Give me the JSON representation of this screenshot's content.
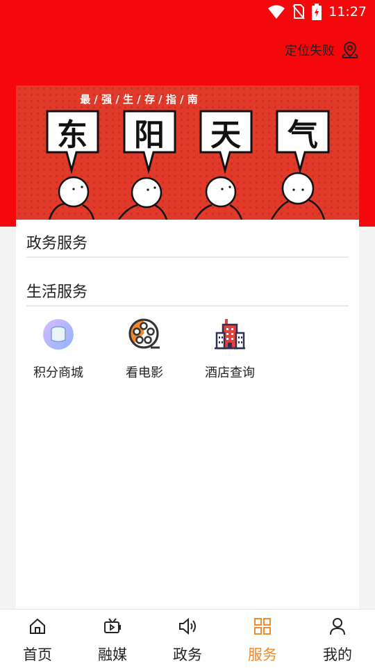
{
  "status_bar": {
    "time": "11:27",
    "icons": [
      "wifi-icon",
      "no-sim-icon",
      "battery-charging-icon"
    ]
  },
  "header": {
    "location_text": "定位失败",
    "location_icon": "map-pin-icon"
  },
  "banner": {
    "tagline": "最 / 强 / 生 / 存 / 指 / 南",
    "characters": [
      "东",
      "阳",
      "天",
      "气"
    ]
  },
  "sections": [
    {
      "title": "政务服务"
    },
    {
      "title": "生活服务"
    }
  ],
  "life_services": [
    {
      "label": "积分商城",
      "icon": "coin-stack-icon"
    },
    {
      "label": "看电影",
      "icon": "film-reel-icon"
    },
    {
      "label": "酒店查询",
      "icon": "hotel-building-icon"
    }
  ],
  "bottom_nav": [
    {
      "label": "首页",
      "icon": "home-icon"
    },
    {
      "label": "融媒",
      "icon": "tv-icon"
    },
    {
      "label": "政务",
      "icon": "speaker-icon"
    },
    {
      "label": "服务",
      "icon": "grid-icon",
      "active": true
    },
    {
      "label": "我的",
      "icon": "person-icon"
    }
  ],
  "colors": {
    "primary_red": "#f4080b",
    "accent_orange": "#f18a2e",
    "banner_red": "#e13a2a"
  }
}
